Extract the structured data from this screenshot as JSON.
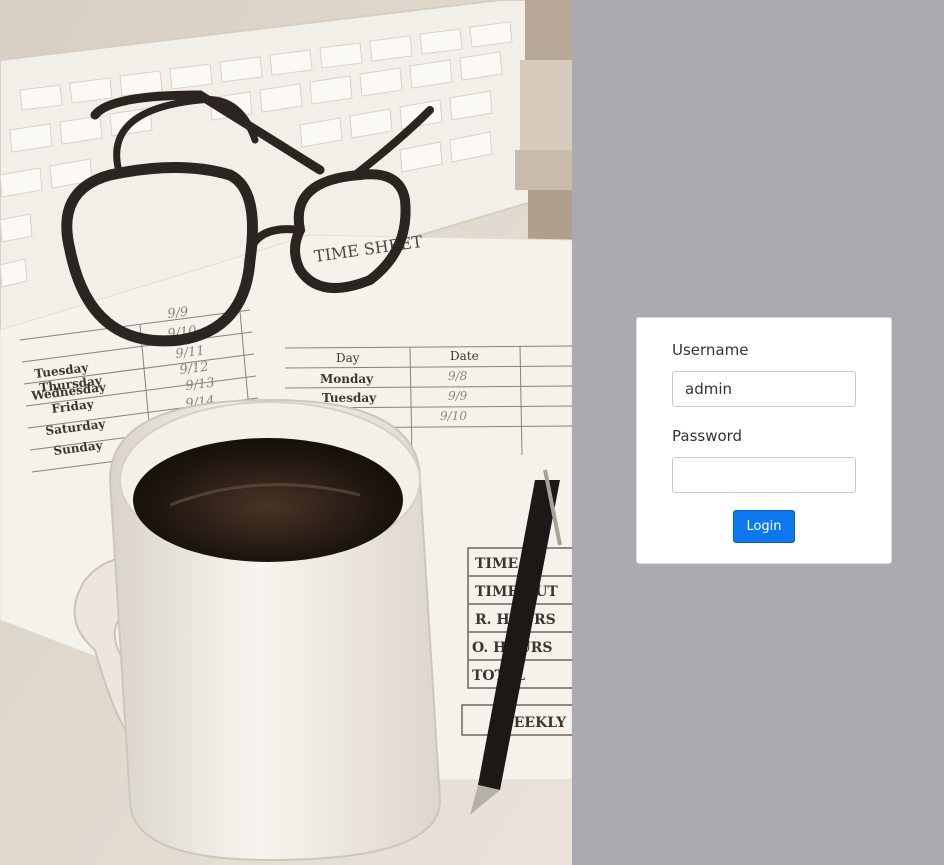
{
  "login_form": {
    "username_label": "Username",
    "username_value": "admin",
    "password_label": "Password",
    "password_value": "",
    "login_button_label": "Login"
  },
  "colors": {
    "page_background": "#a9abaf",
    "card_background": "#ffffff",
    "button_primary": "#0b78f0"
  },
  "photo": {
    "timesheet_title": "TIME SHEET",
    "weekdays_left": [
      "Tuesday",
      "Wednesday",
      "Thursday",
      "Friday",
      "Saturday",
      "Sunday"
    ],
    "dates_left": [
      "9/9",
      "9/10",
      "9/11",
      "9/12",
      "9/13",
      "9/14"
    ],
    "table_headers": [
      "Day",
      "Date"
    ],
    "table_days": [
      "Monday",
      "Tuesday"
    ],
    "table_dates": [
      "9/8",
      "9/9",
      "9/10"
    ],
    "summary_rows": [
      "TIME",
      "TIME OUT",
      "R. HOURS",
      "O. HOURS",
      "TOTAL"
    ],
    "weekly_label": "WEEKLY"
  }
}
